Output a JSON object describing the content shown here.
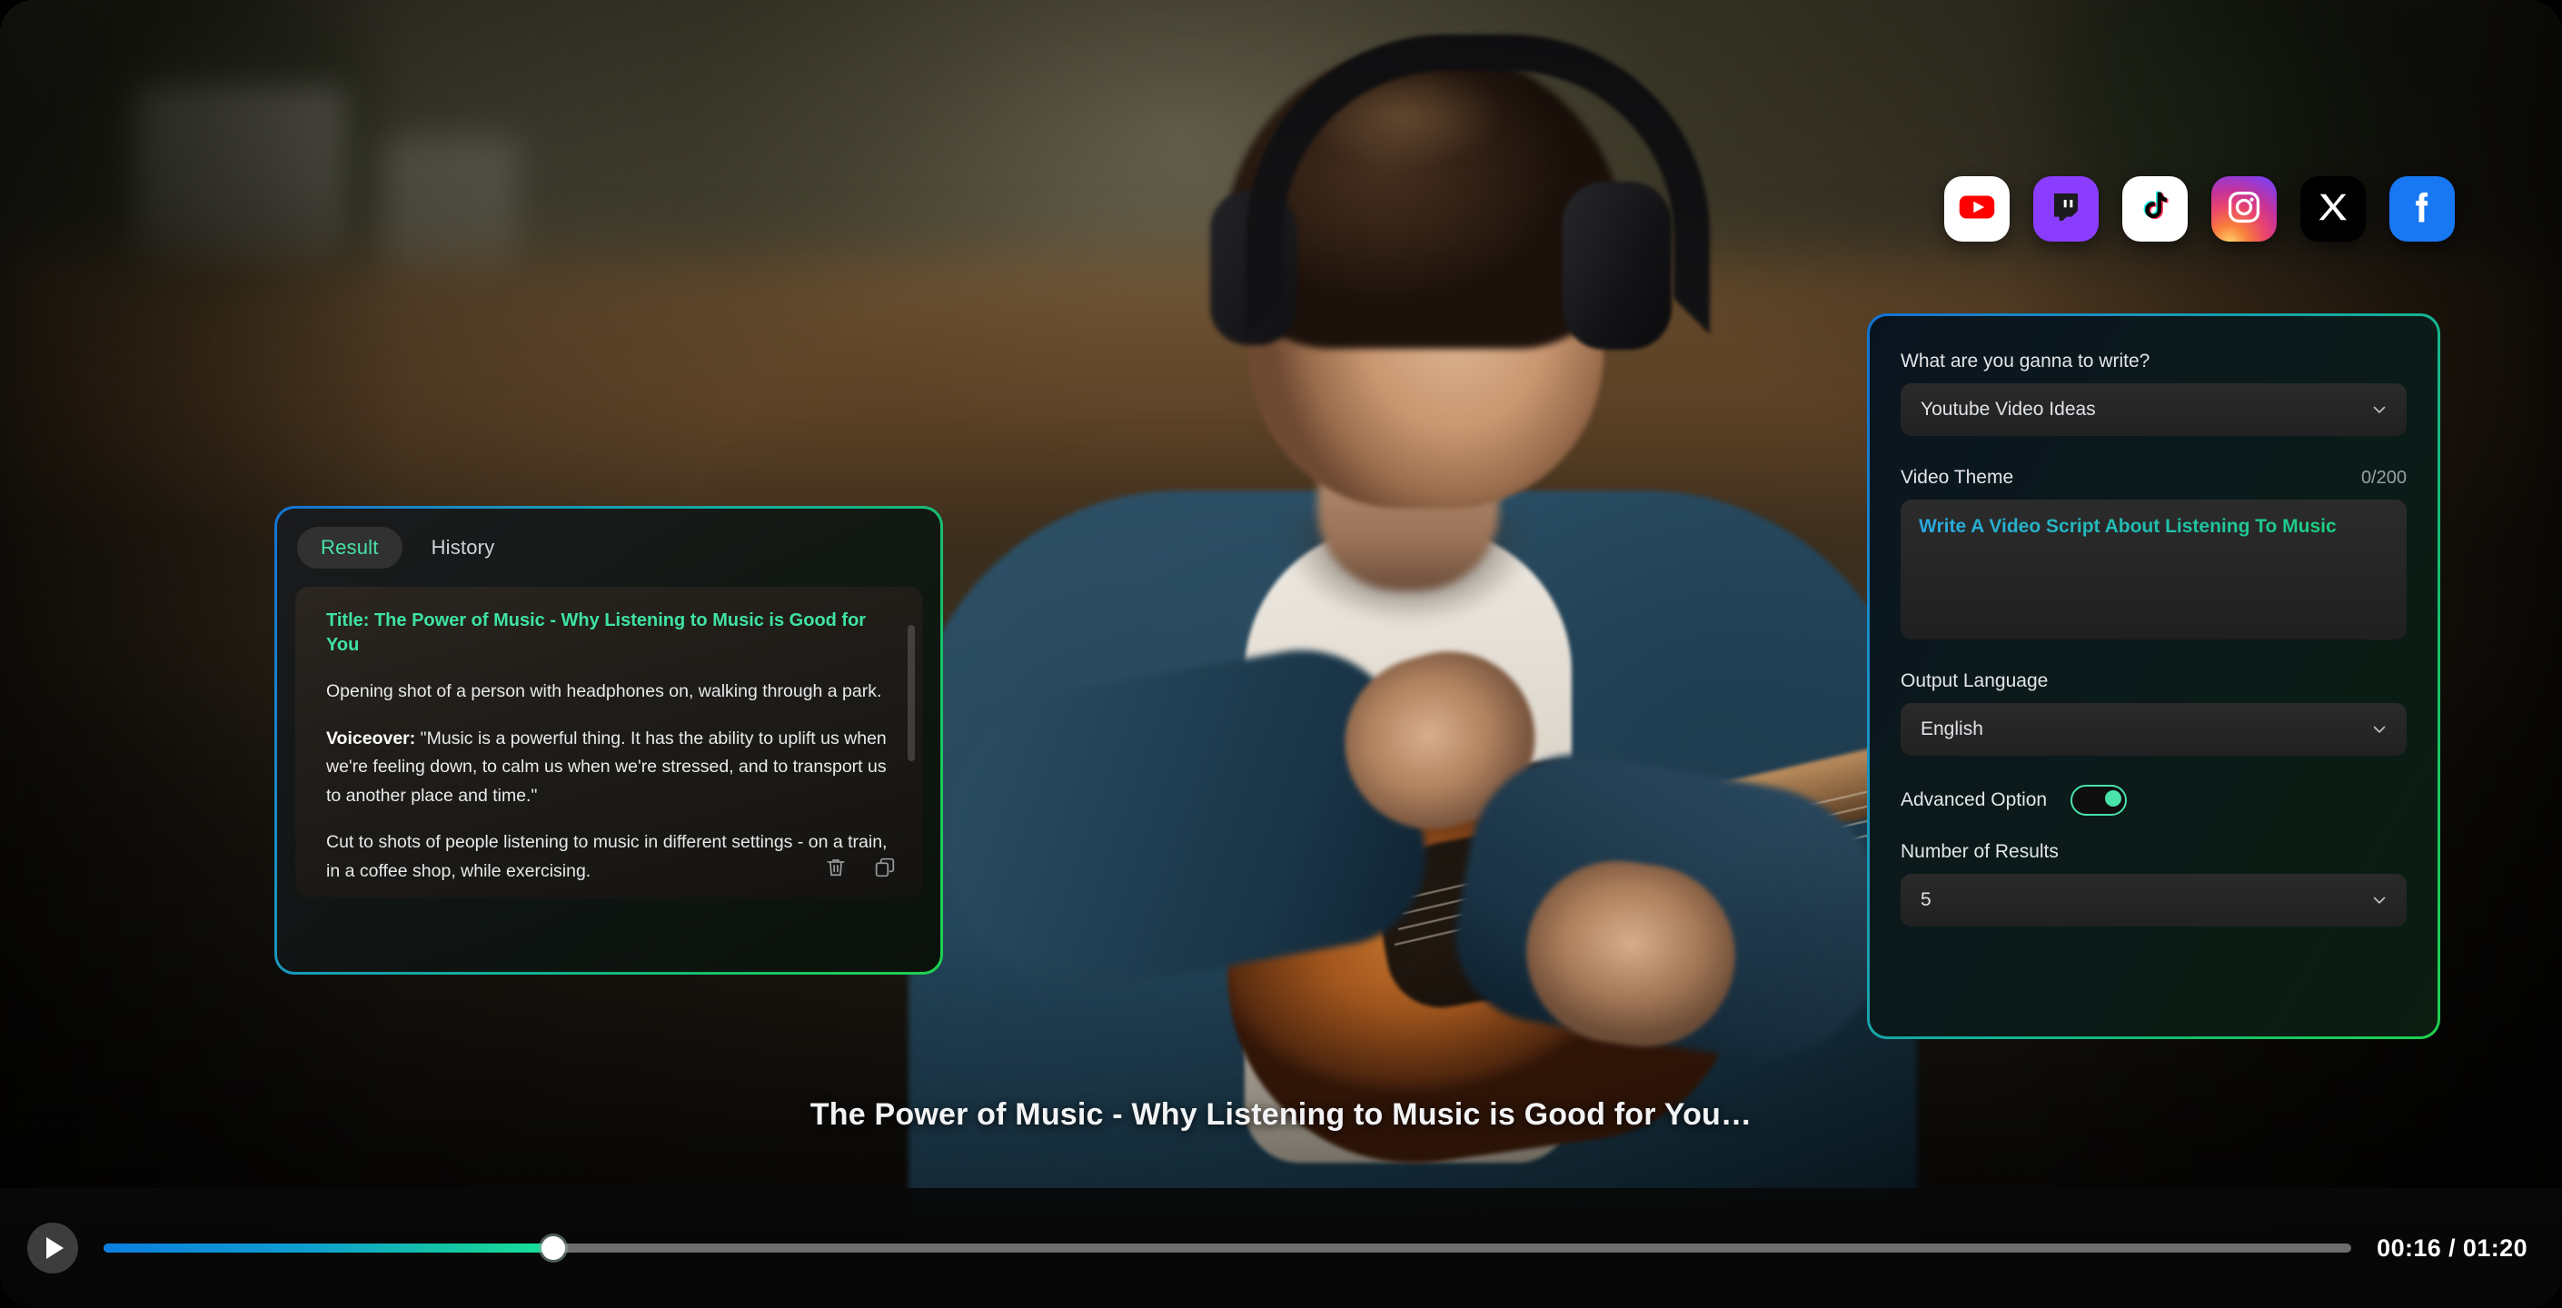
{
  "socials": [
    {
      "name": "youtube-icon",
      "label": "YouTube"
    },
    {
      "name": "twitch-icon",
      "label": "Twitch"
    },
    {
      "name": "tiktok-icon",
      "label": "TikTok"
    },
    {
      "name": "instagram-icon",
      "label": "Instagram"
    },
    {
      "name": "x-icon",
      "label": "X"
    },
    {
      "name": "facebook-icon",
      "label": "Facebook"
    }
  ],
  "result_panel": {
    "tabs": [
      {
        "label": "Result",
        "active": true
      },
      {
        "label": "History",
        "active": false
      }
    ],
    "content": {
      "title": "Title: The Power of Music - Why Listening to Music is Good for You",
      "paragraph_1": "Opening shot of a person with headphones on, walking through a park.",
      "paragraph_2_label": "Voiceover:",
      "paragraph_2_text": " \"Music is a powerful thing. It has the ability to uplift us when we're feeling down, to calm us when we're stressed, and to transport us to another place and time.\"",
      "paragraph_3": "Cut to shots of people listening to music in different settings - on a train, in a coffee shop, while exercising."
    },
    "actions": [
      {
        "name": "delete-icon",
        "label": "Delete"
      },
      {
        "name": "copy-icon",
        "label": "Copy"
      }
    ]
  },
  "form_panel": {
    "write_type": {
      "label": "What are you ganna to write?",
      "value": "Youtube Video Ideas"
    },
    "video_theme": {
      "label": "Video Theme",
      "counter": "0/200",
      "value": "Write A Video Script About Listening To Music"
    },
    "output_language": {
      "label": "Output Language",
      "value": "English"
    },
    "advanced_option": {
      "label": "Advanced Option",
      "state": "on"
    },
    "number_of_results": {
      "label": "Number of Results",
      "value": "5"
    }
  },
  "caption": {
    "text": "The Power of Music - Why Listening to Music is Good for You…"
  },
  "player": {
    "play_label": "Play",
    "current_time": "00:16",
    "total_time": "01:20",
    "time_display": "00:16 / 01:20",
    "progress_percent": 20
  },
  "colors": {
    "accent_green": "#49e2a8",
    "accent_blue": "#1273d4",
    "border_gradient_start": "#1273d4",
    "border_gradient_end": "#1fd14f",
    "panel_bg": "#0b0b0c"
  }
}
